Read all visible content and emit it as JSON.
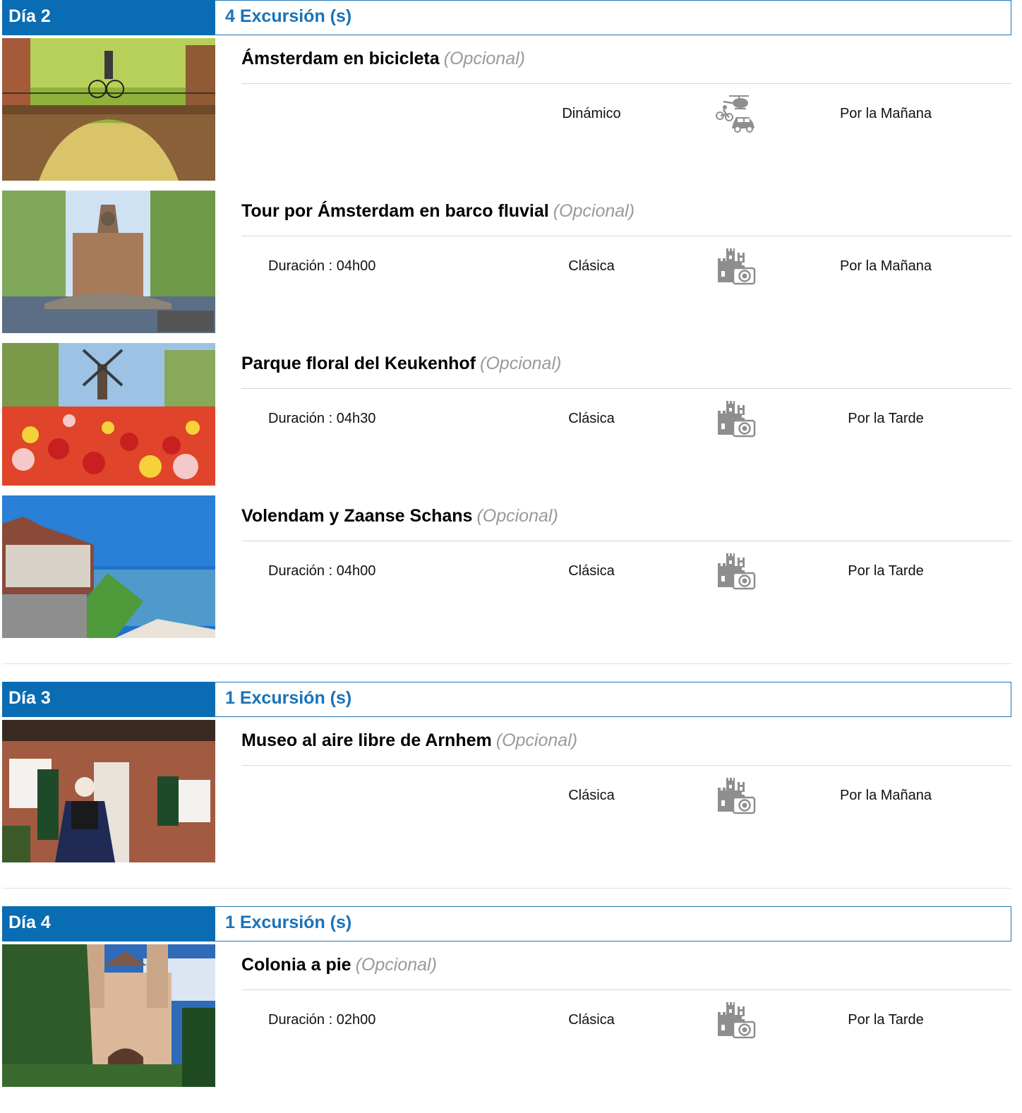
{
  "days": [
    {
      "label": "Día 2",
      "count": "4 Excursión (s)",
      "excursions": [
        {
          "title": "Ámsterdam en bicicleta",
          "optional": "(Opcional)",
          "duration": "",
          "style": "Dinámico",
          "style_icon": "bike-helicopter-car-icon",
          "time": "Por la Mañana",
          "photo": "canal-bridge-cyclist"
        },
        {
          "title": "Tour por Ámsterdam en barco fluvial",
          "optional": "(Opcional)",
          "duration": "Duración : 04h00",
          "style": "Clásica",
          "style_icon": "castle-camera-icon",
          "time": "Por la Mañana",
          "photo": "canal-church"
        },
        {
          "title": "Parque floral del Keukenhof",
          "optional": "(Opcional)",
          "duration": "Duración : 04h30",
          "style": "Clásica",
          "style_icon": "castle-camera-icon",
          "time": "Por la Tarde",
          "photo": "tulips-windmill"
        },
        {
          "title": "Volendam y Zaanse Schans",
          "optional": "(Opcional)",
          "duration": "Duración : 04h00",
          "style": "Clásica",
          "style_icon": "castle-camera-icon",
          "time": "Por la Tarde",
          "photo": "lakeside-houses"
        }
      ]
    },
    {
      "label": "Día 3",
      "count": "1 Excursión (s)",
      "excursions": [
        {
          "title": "Museo al aire libre de Arnhem",
          "optional": "(Opcional)",
          "duration": "",
          "style": "Clásica",
          "style_icon": "castle-camera-icon",
          "time": "Por la Mañana",
          "photo": "brick-house-woman"
        }
      ]
    },
    {
      "label": "Día 4",
      "count": "1 Excursión (s)",
      "excursions": [
        {
          "title": "Colonia a pie",
          "optional": "(Opcional)",
          "duration": "Duración : 02h00",
          "style": "Clásica",
          "style_icon": "castle-camera-icon",
          "time": "Por la Tarde",
          "photo": "romanesque-church"
        }
      ]
    }
  ],
  "colors": {
    "accent": "#0a6cb3",
    "accent_text": "#1a73b8",
    "optional": "#9a9a9a",
    "divider": "#d6d6d6"
  }
}
